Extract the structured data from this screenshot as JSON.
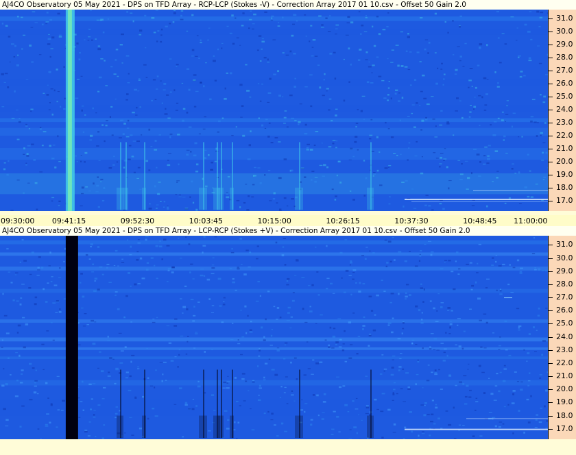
{
  "chart_data": [
    {
      "type": "heatmap",
      "title": "AJ4CO Observatory 05 May 2021  -  DPS on TFD Array  -  RCP-LCP (Stokes -V)  -  Correction Array 2017 01 10.csv  -  Offset 50  Gain 2.0",
      "y_ticks": [
        "31.0",
        "30.0",
        "29.0",
        "28.0",
        "27.0",
        "26.0",
        "25.0",
        "24.0",
        "23.0",
        "22.0",
        "21.0",
        "20.0",
        "19.0",
        "18.0",
        "17.0"
      ],
      "y_values": [
        31,
        30,
        29,
        28,
        27,
        26,
        25,
        24,
        23,
        22,
        21,
        20,
        19,
        18,
        17
      ],
      "ylim": [
        16.2,
        31.7
      ],
      "x_ticks": [
        "09:30:00",
        "09:41:15",
        "09:52:30",
        "10:03:45",
        "10:15:00",
        "10:26:15",
        "10:37:30",
        "10:48:45",
        "11:00:00"
      ],
      "xlim": [
        "09:30:00",
        "11:00:00"
      ],
      "colormap": [
        "#0a2ea6",
        "#1e5ae0",
        "#2f8cf0",
        "#40c8e8",
        "#7cf0b0"
      ],
      "features": {
        "bright_band_time": "09:41:15",
        "bursts_times": [
          "09:52:30",
          "10:03:45",
          "10:15:00",
          "10:26:15"
        ]
      }
    },
    {
      "type": "heatmap",
      "title": "AJ4CO Observatory 05 May 2021  -  DPS on TFD Array  -  LCP-RCP (Stokes +V)  -  Correction Array 2017 01 10.csv  -  Offset 50  Gain 2.0",
      "y_ticks": [
        "31.0",
        "30.0",
        "29.0",
        "28.0",
        "27.0",
        "26.0",
        "25.0",
        "24.0",
        "23.0",
        "22.0",
        "21.0",
        "20.0",
        "19.0",
        "18.0",
        "17.0"
      ],
      "y_values": [
        31,
        30,
        29,
        28,
        27,
        26,
        25,
        24,
        23,
        22,
        21,
        20,
        19,
        18,
        17
      ],
      "ylim": [
        16.2,
        31.7
      ],
      "xlim": [
        "09:30:00",
        "11:00:00"
      ],
      "colormap": [
        "#000010",
        "#0a2ea6",
        "#1e5ae0",
        "#2f8cf0",
        "#4aa8ff"
      ],
      "features": {
        "dark_band_time": "09:41:15"
      }
    }
  ]
}
